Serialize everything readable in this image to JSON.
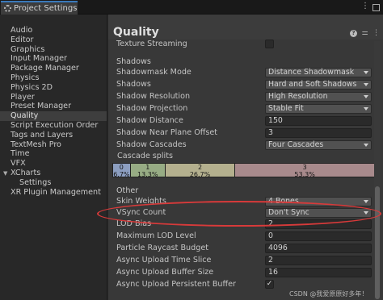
{
  "window": {
    "tab_title": "Project Settings"
  },
  "sidebar": {
    "items": [
      {
        "label": "Audio"
      },
      {
        "label": "Editor"
      },
      {
        "label": "Graphics"
      },
      {
        "label": "Input Manager"
      },
      {
        "label": "Package Manager"
      },
      {
        "label": "Physics"
      },
      {
        "label": "Physics 2D"
      },
      {
        "label": "Player"
      },
      {
        "label": "Preset Manager"
      },
      {
        "label": "Quality",
        "selected": true
      },
      {
        "label": "Script Execution Order"
      },
      {
        "label": "Tags and Layers"
      },
      {
        "label": "TextMesh Pro"
      },
      {
        "label": "Time"
      },
      {
        "label": "VFX"
      },
      {
        "label": "XCharts",
        "expanded": true
      },
      {
        "label": "Settings",
        "child": true
      },
      {
        "label": "XR Plugin Management"
      }
    ]
  },
  "main": {
    "title": "Quality",
    "texture_streaming": {
      "label": "Texture Streaming",
      "checked": false
    },
    "shadows": {
      "header": "Shadows",
      "shadowmask_mode": {
        "label": "Shadowmask Mode",
        "value": "Distance Shadowmask"
      },
      "shadows": {
        "label": "Shadows",
        "value": "Hard and Soft Shadows"
      },
      "shadow_resolution": {
        "label": "Shadow Resolution",
        "value": "High Resolution"
      },
      "shadow_projection": {
        "label": "Shadow Projection",
        "value": "Stable Fit"
      },
      "shadow_distance": {
        "label": "Shadow Distance",
        "value": "150"
      },
      "shadow_near_plane_offset": {
        "label": "Shadow Near Plane Offset",
        "value": "3"
      },
      "shadow_cascades": {
        "label": "Shadow Cascades",
        "value": "Four Cascades"
      },
      "cascade_splits": {
        "label": "Cascade splits",
        "segments": [
          {
            "index": "0",
            "percent": "6.7%",
            "fraction": 0.067,
            "color": "#8c9ec0"
          },
          {
            "index": "1",
            "percent": "13.3%",
            "fraction": 0.133,
            "color": "#97ac84"
          },
          {
            "index": "2",
            "percent": "26.7%",
            "fraction": 0.267,
            "color": "#b4b08e"
          },
          {
            "index": "3",
            "percent": "53.3%",
            "fraction": 0.533,
            "color": "#a88a8c"
          }
        ]
      }
    },
    "other": {
      "header": "Other",
      "skin_weights": {
        "label": "Skin Weights",
        "value": "4 Bones"
      },
      "vsync_count": {
        "label": "VSync Count",
        "value": "Don't Sync"
      },
      "lod_bias": {
        "label": "LOD Bias",
        "value": "2"
      },
      "maximum_lod_level": {
        "label": "Maximum LOD Level",
        "value": "0"
      },
      "particle_raycast_budget": {
        "label": "Particle Raycast Budget",
        "value": "4096"
      },
      "async_upload_time_slice": {
        "label": "Async Upload Time Slice",
        "value": "2"
      },
      "async_upload_buffer_size": {
        "label": "Async Upload Buffer Size",
        "value": "16"
      },
      "async_upload_persistent_buffer": {
        "label": "Async Upload Persistent Buffer",
        "checked": true
      }
    }
  },
  "watermark": "CSDN @我爱原原好多年！",
  "colors": {
    "accent": "#3a79bb",
    "highlight_ellipse": "#d83a3a"
  }
}
